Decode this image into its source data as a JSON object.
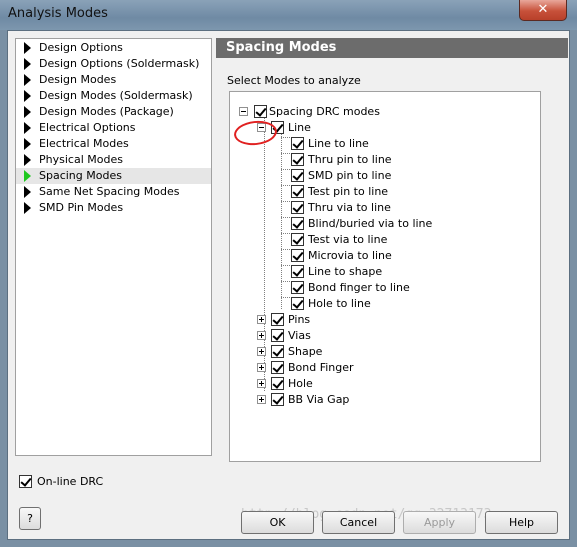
{
  "window": {
    "title": "Analysis Modes",
    "close_label": "✕"
  },
  "nav": {
    "items": [
      {
        "label": "Design Options",
        "selected": false
      },
      {
        "label": "Design Options (Soldermask)",
        "selected": false
      },
      {
        "label": "Design Modes",
        "selected": false
      },
      {
        "label": "Design Modes (Soldermask)",
        "selected": false
      },
      {
        "label": "Design Modes (Package)",
        "selected": false
      },
      {
        "label": "Electrical Options",
        "selected": false
      },
      {
        "label": "Electrical Modes",
        "selected": false
      },
      {
        "label": "Physical Modes",
        "selected": false
      },
      {
        "label": "Spacing Modes",
        "selected": true
      },
      {
        "label": "Same Net Spacing Modes",
        "selected": false
      },
      {
        "label": "SMD Pin Modes",
        "selected": false
      }
    ]
  },
  "panel": {
    "heading": "Spacing Modes",
    "select_label": "Select Modes to analyze"
  },
  "tree": {
    "root": {
      "label": "Spacing DRC modes",
      "checked": true,
      "expanded": true
    },
    "line": {
      "label": "Line",
      "checked": true,
      "expanded": true
    },
    "line_children": [
      {
        "label": "Line to line",
        "checked": true
      },
      {
        "label": "Thru pin to line",
        "checked": true
      },
      {
        "label": "SMD pin to line",
        "checked": true
      },
      {
        "label": "Test pin to line",
        "checked": true
      },
      {
        "label": "Thru via to line",
        "checked": true
      },
      {
        "label": "Blind/buried via to line",
        "checked": true
      },
      {
        "label": "Test via to line",
        "checked": true
      },
      {
        "label": "Microvia to line",
        "checked": true
      },
      {
        "label": "Line to shape",
        "checked": true
      },
      {
        "label": "Bond finger to line",
        "checked": true
      },
      {
        "label": "Hole to line",
        "checked": true
      }
    ],
    "groups": [
      {
        "label": "Pins",
        "checked": true
      },
      {
        "label": "Vias",
        "checked": true
      },
      {
        "label": "Shape",
        "checked": true
      },
      {
        "label": "Bond Finger",
        "checked": true
      },
      {
        "label": "Hole",
        "checked": true
      },
      {
        "label": "BB Via Gap",
        "checked": true
      }
    ]
  },
  "options": {
    "online_drc_label": "On-line DRC",
    "online_drc_checked": true
  },
  "buttons": {
    "help_q": "?",
    "ok": "OK",
    "cancel": "Cancel",
    "apply": "Apply",
    "help": "Help"
  },
  "watermark": "http://blog.csdn.net/qq_32713173"
}
